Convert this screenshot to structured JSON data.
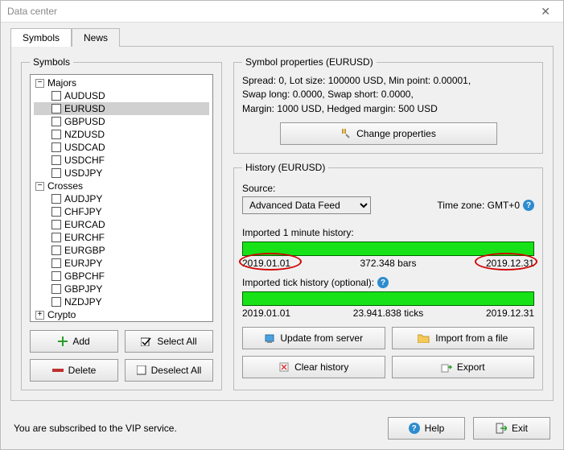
{
  "window": {
    "title": "Data center"
  },
  "tabs": {
    "symbols": "Symbols",
    "news": "News"
  },
  "symbolsPanel": {
    "legend": "Symbols",
    "tree": {
      "groups": [
        {
          "name": "Majors",
          "expanded": true,
          "items": [
            "AUDUSD",
            "EURUSD",
            "GBPUSD",
            "NZDUSD",
            "USDCAD",
            "USDCHF",
            "USDJPY"
          ],
          "selected": "EURUSD"
        },
        {
          "name": "Crosses",
          "expanded": true,
          "items": [
            "AUDJPY",
            "CHFJPY",
            "EURCAD",
            "EURCHF",
            "EURGBP",
            "EURJPY",
            "GBPCHF",
            "GBPJPY",
            "NZDJPY"
          ]
        },
        {
          "name": "Crypto",
          "expanded": false,
          "items": []
        }
      ]
    },
    "buttons": {
      "add": "Add",
      "selectAll": "Select All",
      "delete": "Delete",
      "deselectAll": "Deselect All"
    }
  },
  "propsPanel": {
    "legend": "Symbol properties (EURUSD)",
    "line1": "Spread: 0, Lot size: 100000 USD, Min point: 0.00001,",
    "line2": "Swap long: 0.0000, Swap short: 0.0000,",
    "line3": "Margin: 1000 USD, Hedged margin: 500 USD",
    "changeBtn": "Change properties"
  },
  "historyPanel": {
    "legend": "History (EURUSD)",
    "sourceLabel": "Source:",
    "sourceValue": "Advanced Data Feed",
    "tzLabel": "Time zone: GMT+0",
    "minLabel": "Imported 1 minute history:",
    "minStart": "2019.01.01",
    "minMid": "372.348 bars",
    "minEnd": "2019.12.31",
    "tickLabel": "Imported tick history (optional):",
    "tickStart": "2019.01.01",
    "tickMid": "23.941.838 ticks",
    "tickEnd": "2019.12.31",
    "buttons": {
      "update": "Update from server",
      "import": "Import from a file",
      "clear": "Clear history",
      "export": "Export"
    }
  },
  "footer": {
    "status": "You are subscribed to the VIP service.",
    "help": "Help",
    "exit": "Exit"
  }
}
